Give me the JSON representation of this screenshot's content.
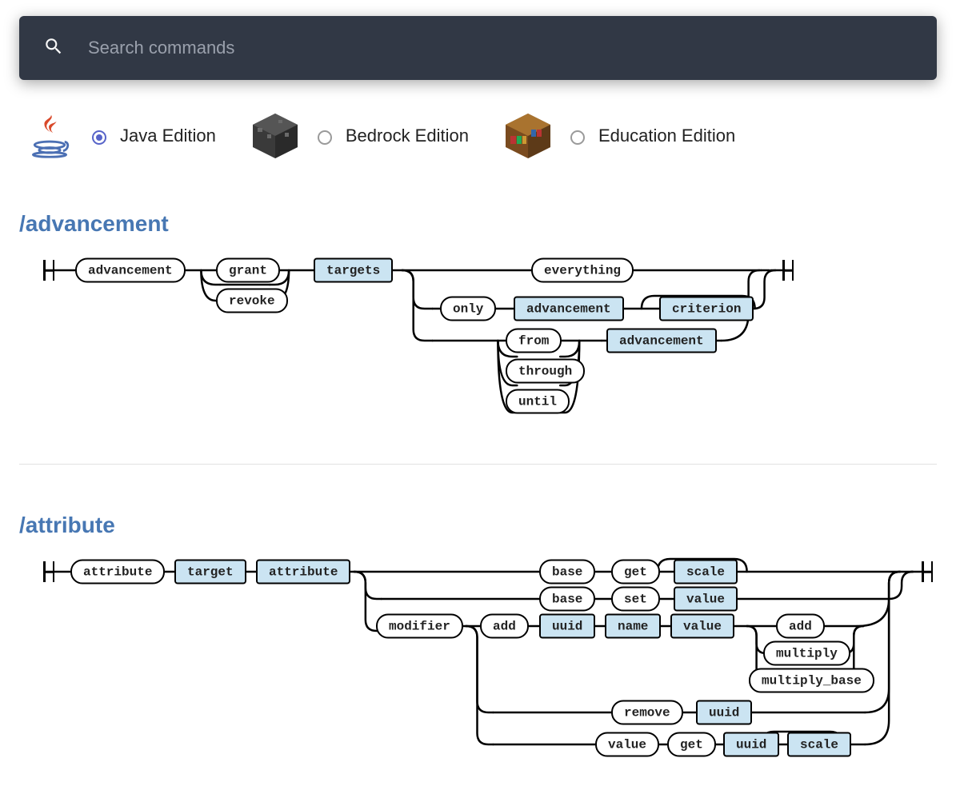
{
  "search": {
    "placeholder": "Search commands"
  },
  "editions": {
    "java": {
      "label": "Java Edition",
      "selected": true
    },
    "bedrock": {
      "label": "Bedrock Edition",
      "selected": false
    },
    "education": {
      "label": "Education Edition",
      "selected": false
    }
  },
  "commands": {
    "advancement": {
      "title": "/advancement",
      "nodes": {
        "root": {
          "text": "advancement",
          "type": "lit"
        },
        "grant": {
          "text": "grant",
          "type": "lit"
        },
        "revoke": {
          "text": "revoke",
          "type": "lit"
        },
        "targets": {
          "text": "targets",
          "type": "arg"
        },
        "everything": {
          "text": "everything",
          "type": "lit"
        },
        "only": {
          "text": "only",
          "type": "lit"
        },
        "adv1": {
          "text": "advancement",
          "type": "arg"
        },
        "criterion": {
          "text": "criterion",
          "type": "arg"
        },
        "from": {
          "text": "from",
          "type": "lit"
        },
        "through": {
          "text": "through",
          "type": "lit"
        },
        "until": {
          "text": "until",
          "type": "lit"
        },
        "adv2": {
          "text": "advancement",
          "type": "arg"
        }
      }
    },
    "attribute": {
      "title": "/attribute",
      "nodes": {
        "root": {
          "text": "attribute",
          "type": "lit"
        },
        "target": {
          "text": "target",
          "type": "arg"
        },
        "attr": {
          "text": "attribute",
          "type": "arg"
        },
        "base1": {
          "text": "base",
          "type": "lit"
        },
        "get1": {
          "text": "get",
          "type": "lit"
        },
        "scale1": {
          "text": "scale",
          "type": "arg"
        },
        "base2": {
          "text": "base",
          "type": "lit"
        },
        "set": {
          "text": "set",
          "type": "lit"
        },
        "value1": {
          "text": "value",
          "type": "arg"
        },
        "modifier": {
          "text": "modifier",
          "type": "lit"
        },
        "add": {
          "text": "add",
          "type": "lit"
        },
        "uuid1": {
          "text": "uuid",
          "type": "arg"
        },
        "name": {
          "text": "name",
          "type": "arg"
        },
        "value2": {
          "text": "value",
          "type": "arg"
        },
        "addop": {
          "text": "add",
          "type": "lit"
        },
        "multiply": {
          "text": "multiply",
          "type": "lit"
        },
        "multiply_base": {
          "text": "multiply_base",
          "type": "lit"
        },
        "remove": {
          "text": "remove",
          "type": "lit"
        },
        "uuid2": {
          "text": "uuid",
          "type": "arg"
        },
        "valuek": {
          "text": "value",
          "type": "lit"
        },
        "get2": {
          "text": "get",
          "type": "lit"
        },
        "uuid3": {
          "text": "uuid",
          "type": "arg"
        },
        "scale2": {
          "text": "scale",
          "type": "arg"
        }
      }
    }
  }
}
